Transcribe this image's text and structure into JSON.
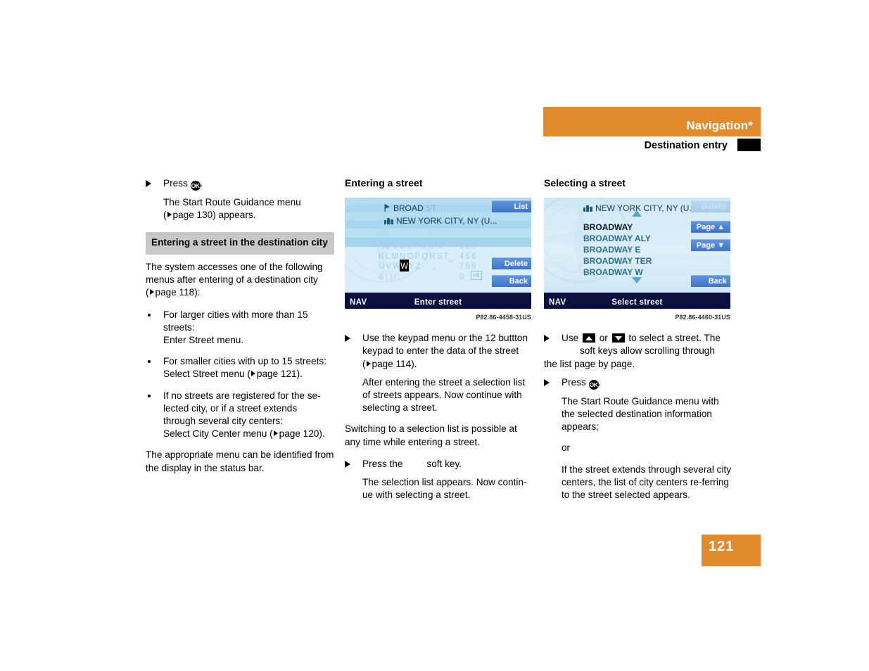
{
  "header": {
    "title": "Navigation*",
    "subtitle": "Destination entry"
  },
  "page_number": "121",
  "column1": {
    "step_press": "Press",
    "step_press_end": ".",
    "step_press_result_1": "The Start Route Guidance menu",
    "step_press_result_2": "page 130) appears.",
    "section_heading": "Entering a street in the destination city",
    "intro_1": "The system accesses one of the following",
    "intro_2": "menus after entering of a destination city",
    "intro_3": "page 118):",
    "bullets": [
      "For larger cities with more than 15 streets:\nEnter Street menu.",
      "For smaller cities with up to 15 streets:\nSelect Street menu (",
      "If no streets are registered for the se-\nlected city, or if a street extends\nthrough several city centers:\nSelect City Center menu ("
    ],
    "bullet2_ref": "page 121).",
    "bullet3_ref": "page 120).",
    "closing": "The appropriate menu can be identified from the display in the status bar."
  },
  "column2": {
    "heading": "Entering a street",
    "screen": {
      "street_entered": "BROAD",
      "street_completion": "ST",
      "city_line": "NEW YORK CITY, NY (U...",
      "keypad_rows": [
        "ABCDEFGHIJ",
        "KLMNOPQRST",
        "UVWXYZ-'.,",
        "&()/;"
      ],
      "keypad_num_rows": [
        "123",
        "456",
        "789",
        "0"
      ],
      "keypad_ok": "ok",
      "cursor_letter": "W",
      "softkeys": [
        "List",
        "Delete",
        "Back"
      ],
      "status_left": "NAV",
      "status_title": "Enter street"
    },
    "figure_caption": "P82.86-4458-31US",
    "step1_a": "Use the keypad menu or the 12 buttton",
    "step1_b": "keypad to enter the data of the street",
    "step1_c": "page 114).",
    "step1_result": "After entering the street a selection list of streets appears. Now continue with selecting a street.",
    "para_switching": "Switching to a selection list is possible at any time while entering a street.",
    "step2_pre": "Press the",
    "step2_post": "soft key.",
    "step2_result": "The selection list appears. Now contin-ue with selecting a street."
  },
  "column3": {
    "heading": "Selecting a street",
    "screen": {
      "city_line": "NEW YORK CITY, NY (U...",
      "list_items": [
        "BROADWAY",
        "BROADWAY ALY",
        "BROADWAY E",
        "BROADWAY TER",
        "BROADWAY W"
      ],
      "selected_index": 0,
      "softkeys": [
        "Details",
        "Page ▲",
        "Page ▼",
        "Back"
      ],
      "softkey_details_disabled": true,
      "status_left": "NAV",
      "status_title": "Select street"
    },
    "figure_caption": "P82.86-4460-31US",
    "step1_pre": "Use",
    "step1_mid": "or",
    "step1_post": "to select a street. The",
    "step1_line2": "soft keys allow scrolling through",
    "step1_line3": "the list page by page.",
    "step2_press": "Press",
    "step2_press_end": ".",
    "step2_result": "The Start Route Guidance menu with the selected destination information appears;",
    "or_text": "or",
    "final_para": "If the street extends through several city centers, the list of city centers re-ferring to the street selected appears."
  },
  "glyphs": {
    "ok_key": "OK",
    "ref_triangle": "▷",
    "arrow_up": "▲",
    "arrow_down": "▼"
  },
  "colors": {
    "brand_orange": "#e28b2e",
    "section_gray": "#c9c9c9",
    "screen_status_navy": "#0b0f3f",
    "softkey_blue": "#4d7fd4"
  }
}
